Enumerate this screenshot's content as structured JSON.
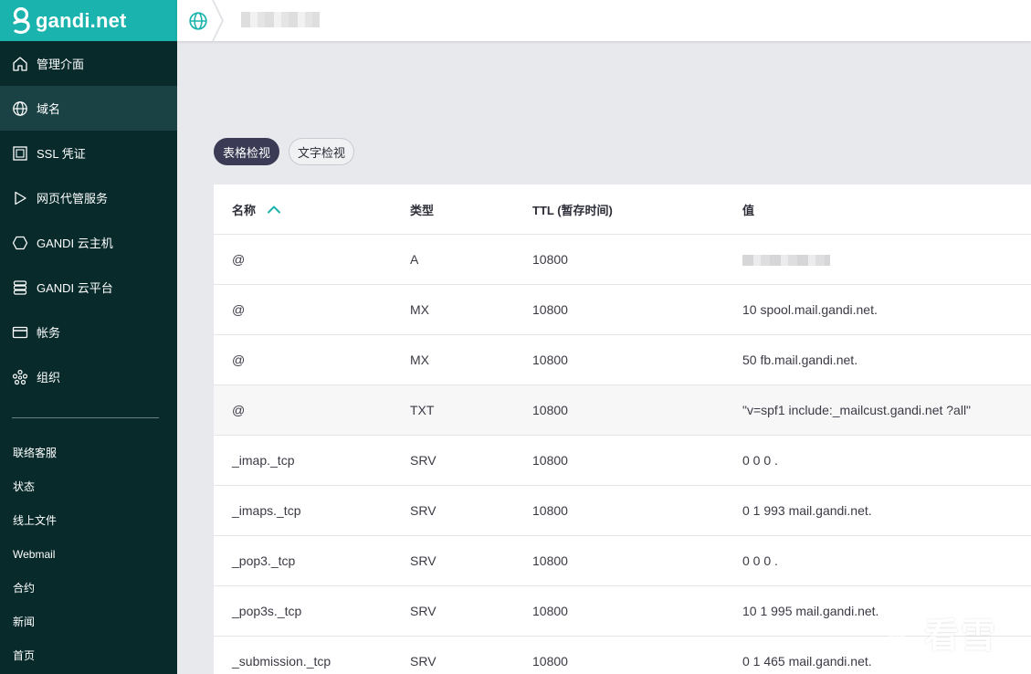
{
  "brand": {
    "name": "gandi.net"
  },
  "sidebar": {
    "items": [
      {
        "label": "管理介面",
        "icon": "home-icon"
      },
      {
        "label": "域名",
        "icon": "globe-icon"
      },
      {
        "label": "SSL 凭证",
        "icon": "certificate-icon"
      },
      {
        "label": "网页代管服务",
        "icon": "play-triangle-icon"
      },
      {
        "label": "GANDI 云主机",
        "icon": "hexagon-icon"
      },
      {
        "label": "GANDI 云平台",
        "icon": "server-stack-icon"
      },
      {
        "label": "帐务",
        "icon": "credit-card-icon"
      },
      {
        "label": "组织",
        "icon": "organization-icon"
      }
    ],
    "active_index": 1,
    "secondary": [
      "联络客服",
      "状态",
      "线上文件",
      "Webmail",
      "合约",
      "新闻",
      "首页"
    ]
  },
  "view_toggle": {
    "table_label": "表格检视",
    "text_label": "文字检视",
    "active": "table"
  },
  "records": {
    "columns": {
      "name": "名称",
      "type": "类型",
      "ttl": "TTL (暂存时间)",
      "value": "值"
    },
    "sort": {
      "column": "name",
      "direction": "asc"
    },
    "rows": [
      {
        "name": "@",
        "type": "A",
        "ttl": "10800",
        "value": ""
      },
      {
        "name": "@",
        "type": "MX",
        "ttl": "10800",
        "value": "10 spool.mail.gandi.net."
      },
      {
        "name": "@",
        "type": "MX",
        "ttl": "10800",
        "value": "50 fb.mail.gandi.net."
      },
      {
        "name": "@",
        "type": "TXT",
        "ttl": "10800",
        "value": "\"v=spf1 include:_mailcust.gandi.net ?all\""
      },
      {
        "name": "_imap._tcp",
        "type": "SRV",
        "ttl": "10800",
        "value": "0 0 0 ."
      },
      {
        "name": "_imaps._tcp",
        "type": "SRV",
        "ttl": "10800",
        "value": "0 1 993 mail.gandi.net."
      },
      {
        "name": "_pop3._tcp",
        "type": "SRV",
        "ttl": "10800",
        "value": "0 0 0 ."
      },
      {
        "name": "_pop3s._tcp",
        "type": "SRV",
        "ttl": "10800",
        "value": "10 1 995 mail.gandi.net."
      },
      {
        "name": "_submission._tcp",
        "type": "SRV",
        "ttl": "10800",
        "value": "0 1 465 mail.gandi.net."
      }
    ]
  },
  "watermark": {
    "text": "看雪",
    "icon": "snowflake-icon"
  },
  "colors": {
    "brand_teal": "#1ab3ad",
    "sidebar_bg": "#082a2b",
    "active_pill": "#3b3b55"
  }
}
